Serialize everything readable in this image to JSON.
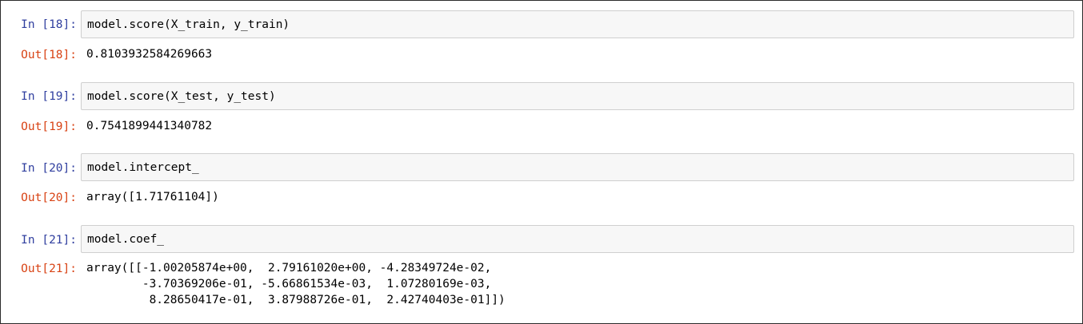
{
  "notebook": {
    "cells": [
      {
        "in_prompt": "In [18]:",
        "code": "model.score(X_train, y_train)",
        "out_prompt": "Out[18]:",
        "output": "0.8103932584269663"
      },
      {
        "in_prompt": "In [19]:",
        "code": "model.score(X_test, y_test)",
        "out_prompt": "Out[19]:",
        "output": "0.7541899441340782"
      },
      {
        "in_prompt": "In [20]:",
        "code": "model.intercept_",
        "out_prompt": "Out[20]:",
        "output": "array([1.71761104])"
      },
      {
        "in_prompt": "In [21]:",
        "code": "model.coef_",
        "out_prompt": "Out[21]:",
        "output_lines": [
          "array([[-1.00205874e+00,  2.79161020e+00, -4.28349724e-02,",
          "        -3.70369206e-01, -5.66861534e-03,  1.07280169e-03,",
          "         8.28650417e-01,  3.87988726e-01,  2.42740403e-01]])"
        ]
      }
    ],
    "colors": {
      "in_prompt": "#303f9f",
      "out_prompt": "#d84315",
      "input_background": "#f7f7f7",
      "input_border": "#cfcfcf"
    }
  }
}
